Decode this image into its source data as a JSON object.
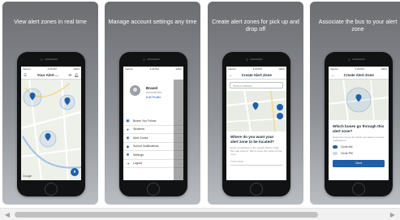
{
  "captions": {
    "panel1": "View alert zones in real time",
    "panel2": "Manage account settings any time",
    "panel3": "Create alert zones for pick up and drop off",
    "panel4": "Associate the bus to your alert zone"
  },
  "screen1": {
    "title": "Your Alert ...",
    "map_label": "Google"
  },
  "screen2": {
    "profile_name": "Brasel",
    "profile_sub": "Account info",
    "profile_link": "Edit Profile",
    "menu": [
      {
        "icon": "bus-icon",
        "label": "Buses You Follow"
      },
      {
        "icon": "students-icon",
        "label": "Students"
      },
      {
        "icon": "pin-icon",
        "label": "Alert Zones"
      },
      {
        "icon": "bell-icon",
        "label": "School Notifications"
      },
      {
        "icon": "gear-icon",
        "label": "Settings"
      },
      {
        "icon": "logout-icon",
        "label": "Logout"
      }
    ]
  },
  "screen3": {
    "title": "Create Alert Zone",
    "search_placeholder": "Search address",
    "sheet_title": "Where do you want your alert zone to be located?",
    "sheet_text": "Enter an address in the search field or drag the map around. Tap to move the center of the zone.",
    "field_label": "Zone name"
  },
  "screen4": {
    "title": "Create Alert Zone",
    "question": "Which buses go through this alert zone?",
    "helper": "Select the buses for which you want to receive notifications.",
    "option1": "Circle AM",
    "option2": "Circle PM",
    "next": "Next"
  },
  "status": {
    "carrier": "Verizon",
    "time": "4:20 PM",
    "battery": "100%"
  },
  "colors": {
    "accent": "#1f5ea8",
    "panel_bg": "#8e9196",
    "route": "#9fc3e6"
  }
}
